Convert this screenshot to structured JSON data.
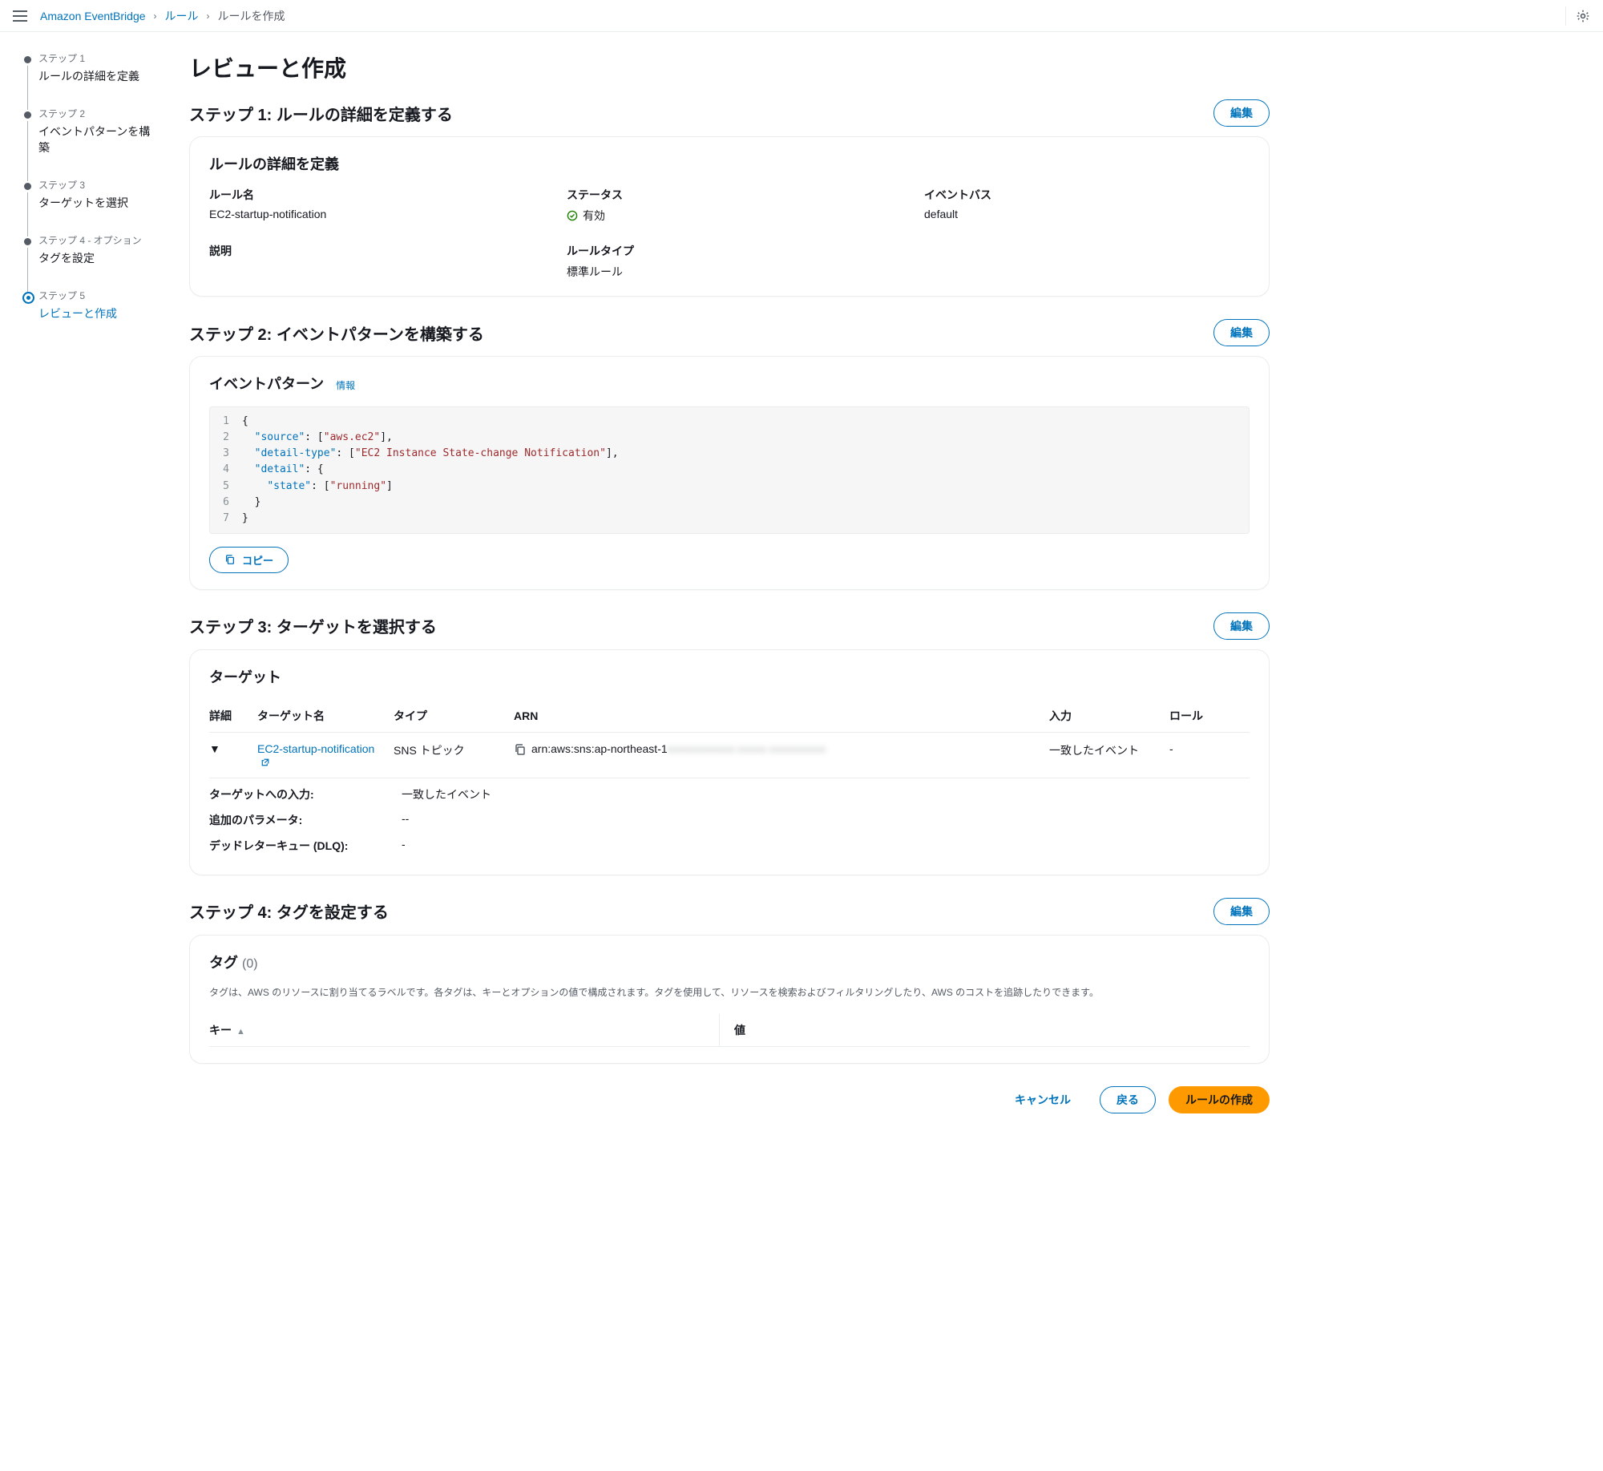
{
  "breadcrumb": {
    "service": "Amazon EventBridge",
    "rules": "ルール",
    "create": "ルールを作成"
  },
  "steps": [
    {
      "num": "ステップ 1",
      "label": "ルールの詳細を定義"
    },
    {
      "num": "ステップ 2",
      "label": "イベントパターンを構築"
    },
    {
      "num": "ステップ 3",
      "label": "ターゲットを選択"
    },
    {
      "num": "ステップ 4 - オプション",
      "label": "タグを設定"
    },
    {
      "num": "ステップ 5",
      "label": "レビューと作成"
    }
  ],
  "page_title": "レビューと作成",
  "edit_label": "編集",
  "sections": {
    "s1": {
      "title": "ステップ 1: ルールの詳細を定義する"
    },
    "s2": {
      "title": "ステップ 2: イベントパターンを構築する"
    },
    "s3": {
      "title": "ステップ 3: ターゲットを選択する"
    },
    "s4": {
      "title": "ステップ 4: タグを設定する"
    }
  },
  "rule_detail": {
    "panel_title": "ルールの詳細を定義",
    "name_k": "ルール名",
    "name_v": "EC2-startup-notification",
    "status_k": "ステータス",
    "status_v": "有効",
    "bus_k": "イベントバス",
    "bus_v": "default",
    "desc_k": "説明",
    "desc_v": "",
    "type_k": "ルールタイプ",
    "type_v": "標準ルール"
  },
  "event_pattern": {
    "panel_title": "イベントパターン",
    "info": "情報",
    "copy": "コピー",
    "json": {
      "source": [
        "aws.ec2"
      ],
      "detail-type": [
        "EC2 Instance State-change Notification"
      ],
      "detail": {
        "state": [
          "running"
        ]
      }
    }
  },
  "targets": {
    "panel_title": "ターゲット",
    "columns": {
      "detail": "詳細",
      "name": "ターゲット名",
      "type": "タイプ",
      "arn": "ARN",
      "input": "入力",
      "role": "ロール"
    },
    "rows": [
      {
        "name": "EC2-startup-notification",
        "type": "SNS トピック",
        "arn_prefix": "arn:aws:sns:ap-northeast-1",
        "arn_redacted": "xxxxxxxxxxxx:xxxxx-xxxxxxxxxx",
        "input": "一致したイベント",
        "role": "-"
      }
    ],
    "detail": {
      "input_k": "ターゲットへの入力:",
      "input_v": "一致したイベント",
      "params_k": "追加のパラメータ:",
      "params_v": "--",
      "dlq_k": "デッドレターキュー (DLQ):",
      "dlq_v": "-"
    }
  },
  "tags": {
    "panel_title": "タグ",
    "count": "(0)",
    "desc": "タグは、AWS のリソースに割り当てるラベルです。各タグは、キーとオプションの値で構成されます。タグを使用して、リソースを検索およびフィルタリングしたり、AWS のコストを追跡したりできます。",
    "columns": {
      "key": "キー",
      "value": "値"
    }
  },
  "footer": {
    "cancel": "キャンセル",
    "back": "戻る",
    "create": "ルールの作成"
  }
}
